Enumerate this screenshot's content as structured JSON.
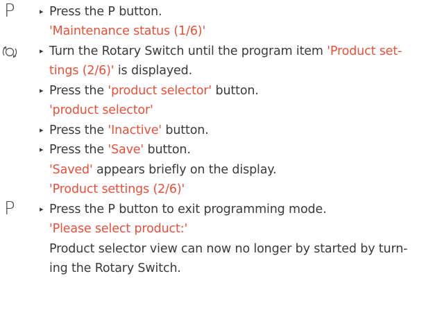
{
  "icons": {
    "p_button": "P",
    "rotary_switch": "rotary-switch-icon"
  },
  "colors": {
    "text": "#3a3a3a",
    "highlight": "#e8503a"
  },
  "lines": {
    "l1": {
      "bullet": "▸",
      "text": "Press the P button."
    },
    "l2": {
      "display": "'Maintenance status (1/6)'"
    },
    "l3": {
      "bullet": "▸",
      "pre": "Turn the Rotary Switch until the program item ",
      "hl": "'Product set-"
    },
    "l4": {
      "hl": "tings (2/6)'",
      "post": " is displayed."
    },
    "l5": {
      "bullet": "▸",
      "pre": "Press the ",
      "hl": "'product selector'",
      "post": " button."
    },
    "l6": {
      "display": "'product selector'"
    },
    "l7": {
      "bullet": "▸",
      "pre": "Press the ",
      "hl": "'Inactive'",
      "post": " button."
    },
    "l8": {
      "bullet": "▸",
      "pre": "Press the ",
      "hl": "'Save'",
      "post": " button."
    },
    "l9": {
      "hl": "'Saved'",
      "post": " appears briefly on the display."
    },
    "l10": {
      "display": "'Product settings (2/6)'"
    },
    "l11": {
      "bullet": "▸",
      "text": "Press the P button to exit programming mode."
    },
    "l12": {
      "display": "'Please select product:'"
    },
    "l13": {
      "text": "Product selector view can now no longer by started by turn-"
    },
    "l14": {
      "text": "ing the Rotary Switch."
    }
  }
}
